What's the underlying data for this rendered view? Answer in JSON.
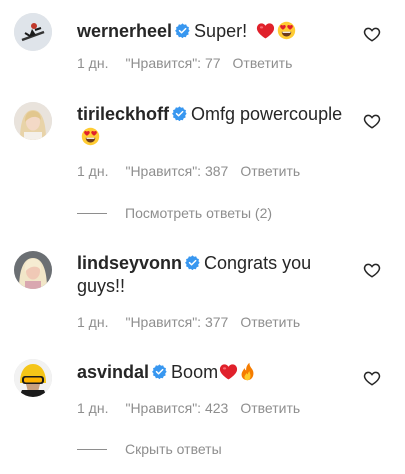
{
  "comments": [
    {
      "username": "wernerheel",
      "text": "Super!",
      "emojis": [
        "red-heart",
        "heart-eyes-face"
      ],
      "time": "1 дн.",
      "likes": "\"Нравится\": 77",
      "reply": "Ответить",
      "avatar_icon": "skier-avatar"
    },
    {
      "username": "tirileckhoff",
      "text": "Omfg powercouple",
      "emojis": [
        "heart-eyes-face"
      ],
      "time": "1 дн.",
      "likes": "\"Нравится\": 387",
      "reply": "Ответить",
      "view_replies": "Посмотреть ответы (2)",
      "avatar_icon": "blonde-woman-avatar"
    },
    {
      "username": "lindseyvonn",
      "text": "Congrats you guys!!",
      "emojis": [],
      "time": "1 дн.",
      "likes": "\"Нравится\": 377",
      "reply": "Ответить",
      "avatar_icon": "blonde-woman-avatar"
    },
    {
      "username": "asvindal",
      "text": "Boom",
      "emojis": [
        "red-heart",
        "fire"
      ],
      "time": "1 дн.",
      "likes": "\"Нравится\": 423",
      "reply": "Ответить",
      "hide_replies": "Скрыть ответы",
      "avatar_icon": "helmet-avatar"
    }
  ],
  "colors": {
    "text": "#262626",
    "meta": "#8e8e8e",
    "verified": "#3897f0",
    "heart": "#ed4956"
  }
}
